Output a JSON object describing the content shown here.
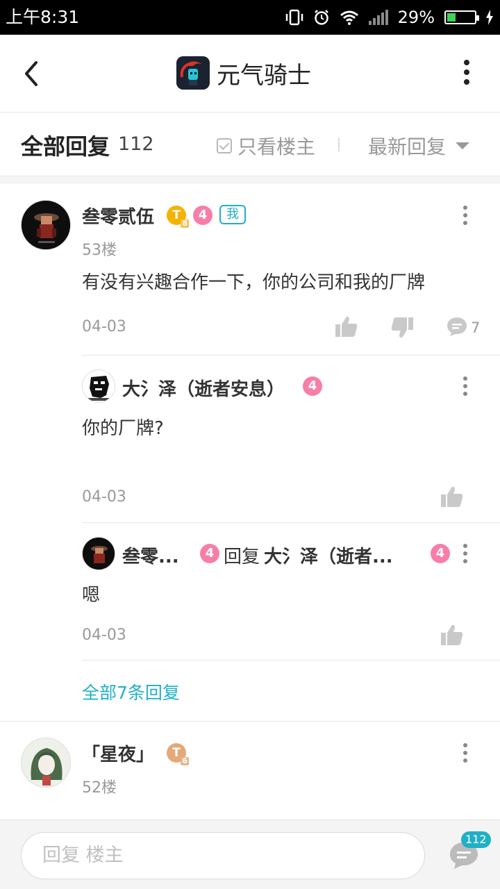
{
  "status_bar": {
    "time": "上午8:31",
    "battery_percent": "29%",
    "battery_level": 0.29
  },
  "header": {
    "title": "元气骑士"
  },
  "filter_bar": {
    "all_replies_label": "全部回复",
    "reply_count": "112",
    "only_op_label": "只看楼主",
    "sort_label": "最新回复"
  },
  "posts": [
    {
      "username": "叁零贰伍",
      "coin_badge": "T",
      "coin_badge_sub": "8",
      "level": "4",
      "me_badge": "我",
      "floor": "53楼",
      "content": "有没有兴趣合作一下，你的公司和我的厂牌",
      "date": "04-03",
      "comment_count": "7",
      "replies": [
        {
          "username": "大氵泽（逝者安息）",
          "level": "4",
          "content": "你的厂牌?",
          "date": "04-03"
        },
        {
          "username": "叁零...",
          "level": "4",
          "reply_word": "回复",
          "reply_to": "大氵泽（逝者...",
          "reply_to_level": "4",
          "content": "嗯",
          "date": "04-03"
        }
      ],
      "more_replies": "全部7条回复"
    },
    {
      "username": "「星夜」",
      "coin_badge": "T",
      "coin_badge_sub": "6",
      "floor": "52楼"
    }
  ],
  "bottom_bar": {
    "placeholder": "回复  楼主",
    "comment_badge": "112"
  },
  "colors": {
    "accent": "#1fb0c6",
    "level_badge": "#f77ea8",
    "gold_badge": "#f5b300"
  }
}
